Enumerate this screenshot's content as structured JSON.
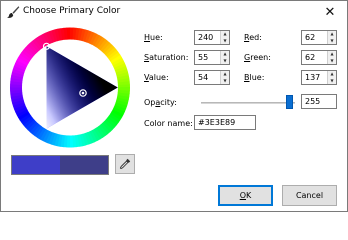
{
  "window": {
    "title": "Choose Primary Color",
    "close_symbol": "✕",
    "title_icon": "paintbrush-icon"
  },
  "fields": {
    "hue": {
      "label_mnemonic": "H",
      "label_rest": "ue:",
      "value": "240"
    },
    "saturation": {
      "label_mnemonic": "S",
      "label_rest": "aturation:",
      "value": "55"
    },
    "value": {
      "label_mnemonic": "V",
      "label_rest": "alue:",
      "value": "54"
    },
    "red": {
      "label_mnemonic": "R",
      "label_rest": "ed:",
      "value": "62"
    },
    "green": {
      "label_mnemonic": "G",
      "label_rest": "reen:",
      "value": "62"
    },
    "blue": {
      "label_mnemonic": "B",
      "label_rest": "lue:",
      "value": "137"
    }
  },
  "opacity": {
    "label_pre": "Op",
    "label_mnemonic": "a",
    "label_rest": "city:",
    "value": "255",
    "level": 1.0
  },
  "color_name": {
    "label": "Color name:",
    "value": "#3E3E89"
  },
  "swatches": {
    "primary": "#3e3e89",
    "previous": "#3e3ec8",
    "eyedropper_icon": "eyedropper-icon"
  },
  "buttons": {
    "ok_mnemonic": "O",
    "ok_rest": "K",
    "cancel": "Cancel"
  },
  "colors": {
    "accent": "#0a6ed1",
    "current": "#3e3e89"
  }
}
